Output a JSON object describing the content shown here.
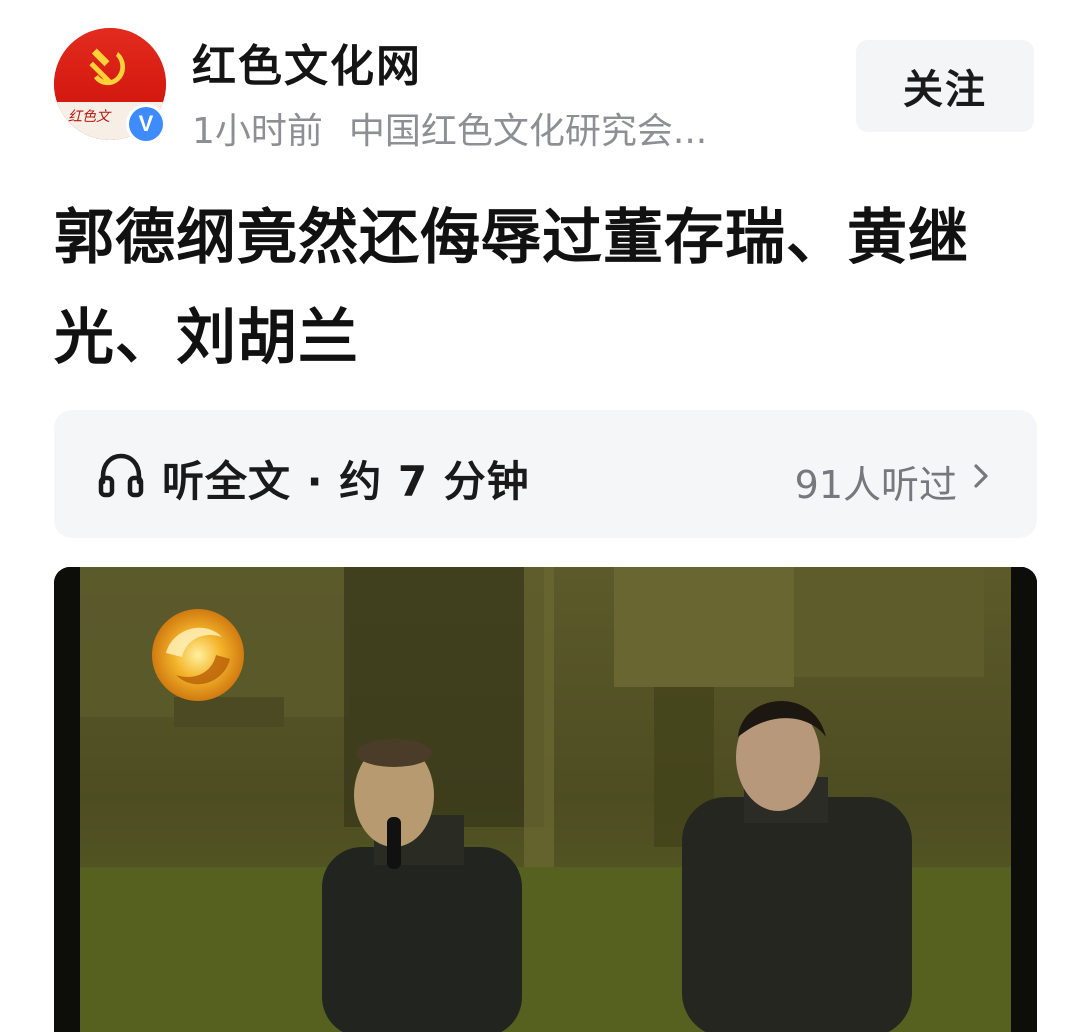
{
  "account": {
    "name": "红色文化网",
    "verified_badge": "V",
    "avatar_signature": "红色文",
    "avatar_icon": "hammer-sickle-icon"
  },
  "meta": {
    "time": "1小时前",
    "source": "中国红色文化研究会..."
  },
  "follow_button": {
    "label": "关注"
  },
  "article": {
    "title": "郭德纲竟然还侮辱过董存瑞、黄继光、刘胡兰"
  },
  "listen": {
    "icon": "headphones-icon",
    "label": "听全文 · 约 7 分钟",
    "listeners": "91人听过",
    "chevron": "chevron-right-icon"
  },
  "video": {
    "logo_icon": "phoenix-logo-icon",
    "description_hidden": false
  },
  "colors": {
    "meta_gray": "#8d8f94",
    "listen_bg": "#f5f6f8",
    "verified_blue": "#3d8bfd",
    "avatar_red": "#d81e16"
  }
}
